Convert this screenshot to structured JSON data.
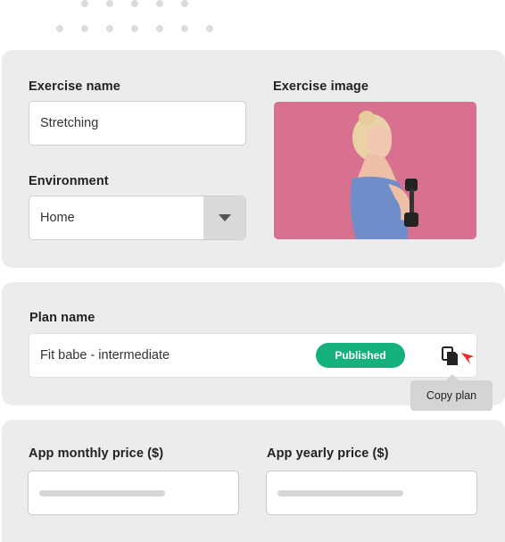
{
  "exercise": {
    "name_label": "Exercise name",
    "name_value": "Stretching",
    "image_label": "Exercise image",
    "environment_label": "Environment",
    "environment_value": "Home"
  },
  "plan": {
    "name_label": "Plan name",
    "name_value": "Fit babe - intermediate",
    "status_badge": "Published",
    "copy_tooltip": "Copy plan",
    "icons": [
      "copy-icon",
      "cursor-pointer-icon"
    ],
    "badge_color": "#16b07a"
  },
  "pricing": {
    "monthly_label": "App monthly price ($)",
    "yearly_label": "App yearly price ($)"
  }
}
